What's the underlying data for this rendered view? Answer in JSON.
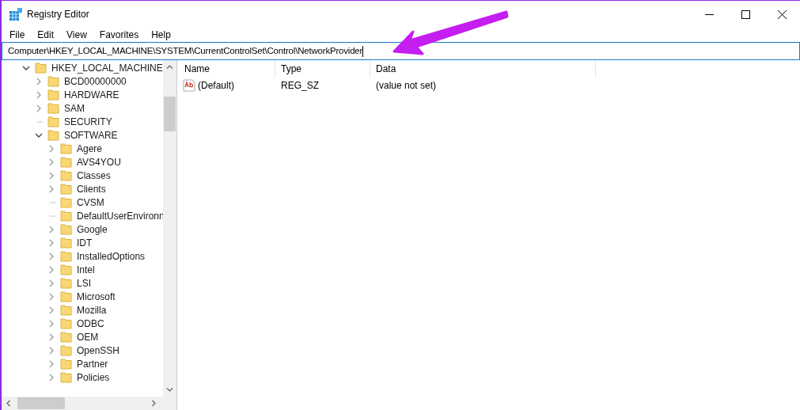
{
  "window": {
    "title": "Registry Editor"
  },
  "menu": [
    "File",
    "Edit",
    "View",
    "Favorites",
    "Help"
  ],
  "address_bar": {
    "value": "Computer\\HKEY_LOCAL_MACHINE\\SYSTEM\\CurrentControlSet\\Control\\NetworkProvider"
  },
  "tree": [
    {
      "label": "HKEY_LOCAL_MACHINE",
      "kind": "expanded",
      "children": [
        {
          "label": "BCD00000000",
          "kind": "collapsed"
        },
        {
          "label": "HARDWARE",
          "kind": "collapsed"
        },
        {
          "label": "SAM",
          "kind": "collapsed"
        },
        {
          "label": "SECURITY",
          "kind": "leaf"
        },
        {
          "label": "SOFTWARE",
          "kind": "expanded",
          "children": [
            {
              "label": "Agere",
              "kind": "collapsed"
            },
            {
              "label": "AVS4YOU",
              "kind": "collapsed"
            },
            {
              "label": "Classes",
              "kind": "collapsed"
            },
            {
              "label": "Clients",
              "kind": "collapsed"
            },
            {
              "label": "CVSM",
              "kind": "leaf"
            },
            {
              "label": "DefaultUserEnvironn",
              "kind": "leaf"
            },
            {
              "label": "Google",
              "kind": "collapsed"
            },
            {
              "label": "IDT",
              "kind": "collapsed"
            },
            {
              "label": "InstalledOptions",
              "kind": "collapsed"
            },
            {
              "label": "Intel",
              "kind": "collapsed"
            },
            {
              "label": "LSI",
              "kind": "collapsed"
            },
            {
              "label": "Microsoft",
              "kind": "collapsed"
            },
            {
              "label": "Mozilla",
              "kind": "collapsed"
            },
            {
              "label": "ODBC",
              "kind": "collapsed"
            },
            {
              "label": "OEM",
              "kind": "collapsed"
            },
            {
              "label": "OpenSSH",
              "kind": "collapsed"
            },
            {
              "label": "Partner",
              "kind": "collapsed"
            },
            {
              "label": "Policies",
              "kind": "collapsed"
            }
          ]
        }
      ]
    }
  ],
  "values_list": {
    "columns": [
      "Name",
      "Type",
      "Data"
    ],
    "rows": [
      {
        "name": "(Default)",
        "type": "REG_SZ",
        "data": "(value not set)"
      }
    ]
  }
}
